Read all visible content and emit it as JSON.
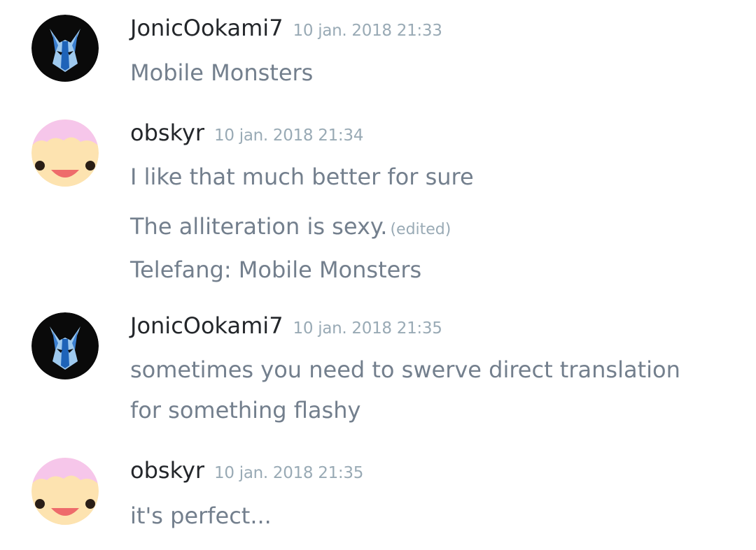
{
  "messages": [
    {
      "author": "JonicOokami7",
      "timestamp": "10 jan. 2018 21:33",
      "avatar": "blue-wolf-mask-avatar",
      "lines": [
        "Mobile Monsters"
      ]
    },
    {
      "author": "obskyr",
      "timestamp": "10 jan. 2018 21:34",
      "avatar": "pink-haired-smiley-avatar",
      "lines": [
        "I like that much better for sure",
        "The alliteration is sexy.",
        "Telefang: Mobile Monsters"
      ],
      "edited_label": "(edited)"
    },
    {
      "author": "JonicOokami7",
      "timestamp": "10 jan. 2018 21:35",
      "avatar": "blue-wolf-mask-avatar",
      "lines": [
        "sometimes you need to swerve direct translation",
        "for something flashy"
      ]
    },
    {
      "author": "obskyr",
      "timestamp": "10 jan. 2018 21:35",
      "avatar": "pink-haired-smiley-avatar",
      "lines": [
        "it's perfect..."
      ]
    }
  ],
  "colors": {
    "author": "#23262a",
    "timestamp": "#99aab5",
    "message": "#737f8d",
    "background": "#ffffff"
  }
}
